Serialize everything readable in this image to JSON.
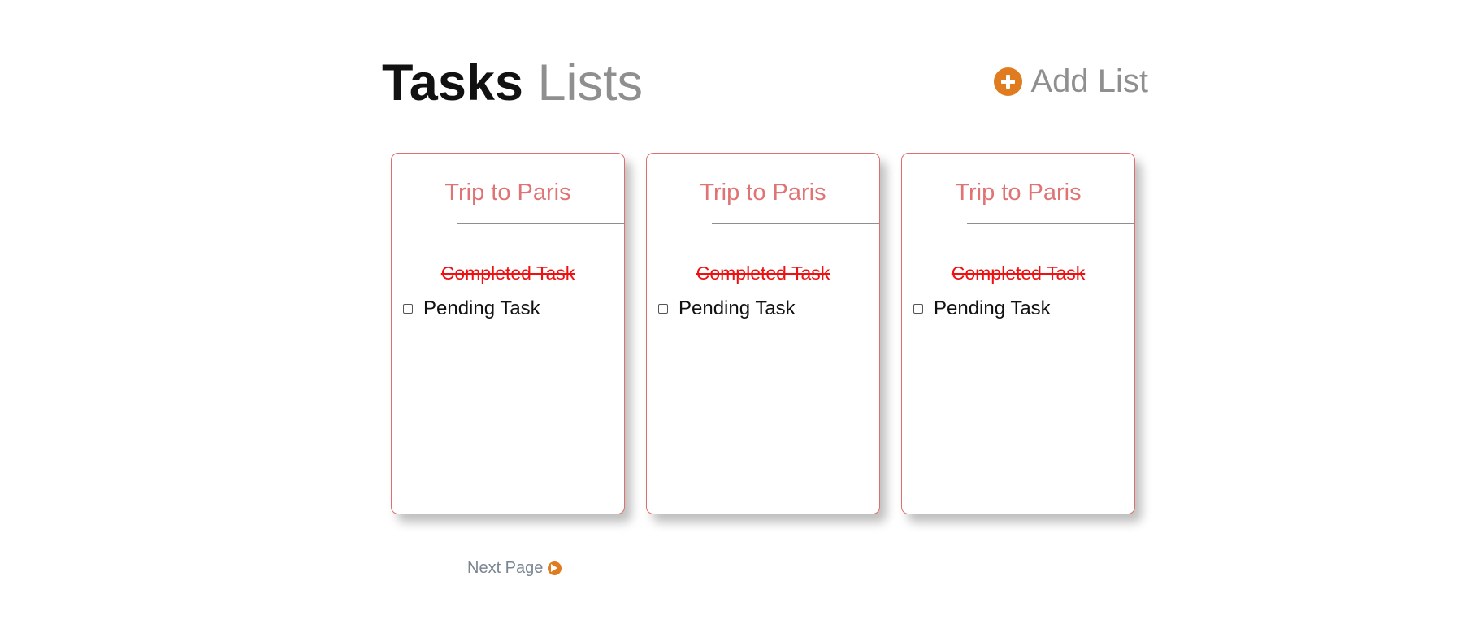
{
  "header": {
    "title_bold": "Tasks",
    "title_light": "Lists",
    "add_list_label": "Add List",
    "add_icon": "plus-circle-icon"
  },
  "lists": [
    {
      "title": "Trip to Paris",
      "completed_task": "Completed Task",
      "pending_task": "Pending Task",
      "pending_checked": false
    },
    {
      "title": "Trip to Paris",
      "completed_task": "Completed Task",
      "pending_task": "Pending Task",
      "pending_checked": false
    },
    {
      "title": "Trip to Paris",
      "completed_task": "Completed Task",
      "pending_task": "Pending Task",
      "pending_checked": false
    }
  ],
  "pagination": {
    "next_label": "Next Page",
    "next_icon": "arrow-circle-right-icon"
  },
  "colors": {
    "accent": "#e07b1f",
    "card_border": "#df6f6f",
    "list_title": "#e07373",
    "completed_text": "#ee1111",
    "muted": "#8f8f8f"
  }
}
